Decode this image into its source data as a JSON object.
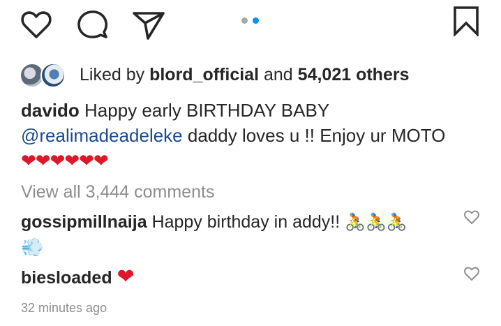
{
  "actions": {
    "like_icon": "heart-outline-icon",
    "comment_icon": "comment-bubble-icon",
    "share_icon": "paper-plane-icon",
    "save_icon": "bookmark-icon"
  },
  "carousel": {
    "count": 2,
    "active": 2
  },
  "likes": {
    "prefix": "Liked by",
    "user": "blord_official",
    "and": "and",
    "others": "54,021 others"
  },
  "caption": {
    "username": "davido",
    "text1": "Happy early BIRTHDAY BABY",
    "mention": "@realimadeadeleke",
    "text2": "daddy loves u !! Enjoy ur MOTO",
    "emojis": "❤❤❤❤❤❤"
  },
  "view_all": "View all 3,444 comments",
  "comments": [
    {
      "username": "gossipmillnaija",
      "text": "Happy birthday in addy!!",
      "emojis": "🚴🚴🚴",
      "emoji2": "💨"
    },
    {
      "username": "biesloaded",
      "emojis": "❤"
    }
  ],
  "timestamp": "32 minutes ago",
  "colors": {
    "accent": "#0095f6",
    "heart": "#e0172b",
    "mention": "#1c4a8f",
    "muted": "#8e8e8e"
  }
}
